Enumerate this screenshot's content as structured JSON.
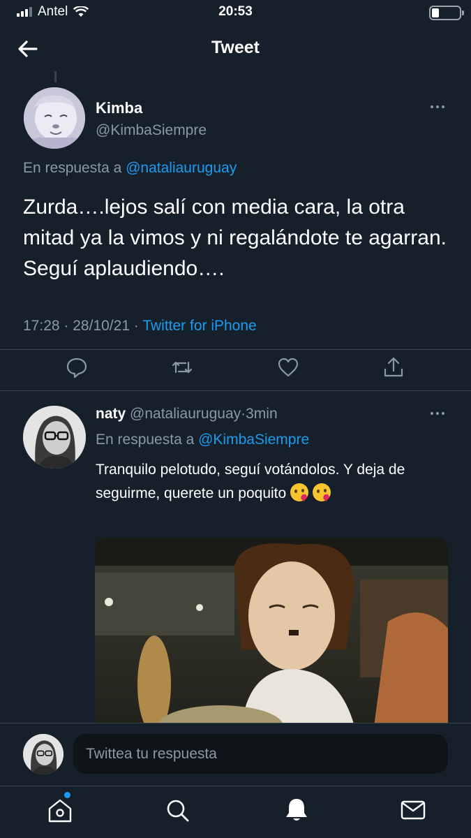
{
  "status_bar": {
    "carrier": "Antel",
    "time": "20:53",
    "battery_level": 0.25
  },
  "header": {
    "title": "Tweet"
  },
  "main_tweet": {
    "name": "Kimba",
    "handle": "@KimbaSiempre",
    "reply_prefix": "En respuesta a",
    "reply_to": "@nataliauruguay",
    "text": "Zurda….lejos salí con media cara, la otra mitad ya la vimos y ni regalándote te agarran. Seguí aplaudiendo….",
    "time": "17:28",
    "date": "28/10/21",
    "separator": "·",
    "source": "Twitter for iPhone"
  },
  "reply_tweet": {
    "name": "naty",
    "handle": "@nataliauruguay",
    "separator": "·",
    "age": "3min",
    "reply_prefix": "En respuesta a",
    "reply_to": "@KimbaSiempre",
    "text": "Tranquilo pelotudo, seguí votándolos. Y deja de seguirme, querete un poquito"
  },
  "composer": {
    "placeholder": "Twittea tu respuesta"
  },
  "colors": {
    "background": "#15202b",
    "accent": "#1d9bf0",
    "secondary_text": "#8b98a5",
    "divider": "#38444d"
  },
  "icons": {
    "back": "arrow-left-icon",
    "more": "more-horizontal-icon",
    "reply": "comment-icon",
    "retweet": "retweet-icon",
    "like": "heart-icon",
    "share": "share-icon",
    "home": "home-icon",
    "search": "search-icon",
    "notifications": "bell-icon",
    "messages": "envelope-icon"
  }
}
